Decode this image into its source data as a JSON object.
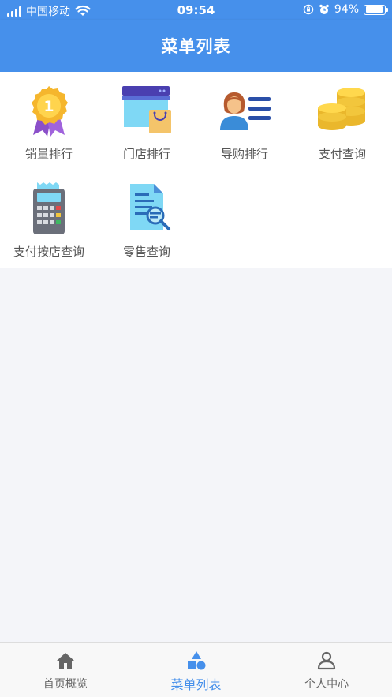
{
  "status_bar": {
    "carrier": "中国移动",
    "time": "09:54",
    "battery": "94%"
  },
  "header": {
    "title": "菜单列表"
  },
  "menu": {
    "items": [
      {
        "label": "销量排行",
        "icon": "gold-medal-icon"
      },
      {
        "label": "门店排行",
        "icon": "store-bag-icon"
      },
      {
        "label": "导购排行",
        "icon": "salesperson-list-icon"
      },
      {
        "label": "支付查询",
        "icon": "coin-stacks-icon"
      },
      {
        "label": "支付按店查询",
        "icon": "pos-terminal-icon"
      },
      {
        "label": "零售查询",
        "icon": "document-search-icon"
      }
    ]
  },
  "tab_bar": {
    "tabs": [
      {
        "label": "首页概览",
        "icon": "home-icon",
        "active": false
      },
      {
        "label": "菜单列表",
        "icon": "shapes-icon",
        "active": true
      },
      {
        "label": "个人中心",
        "icon": "user-icon",
        "active": false
      }
    ]
  },
  "colors": {
    "primary": "#4690eb",
    "background": "#f4f5f9"
  }
}
